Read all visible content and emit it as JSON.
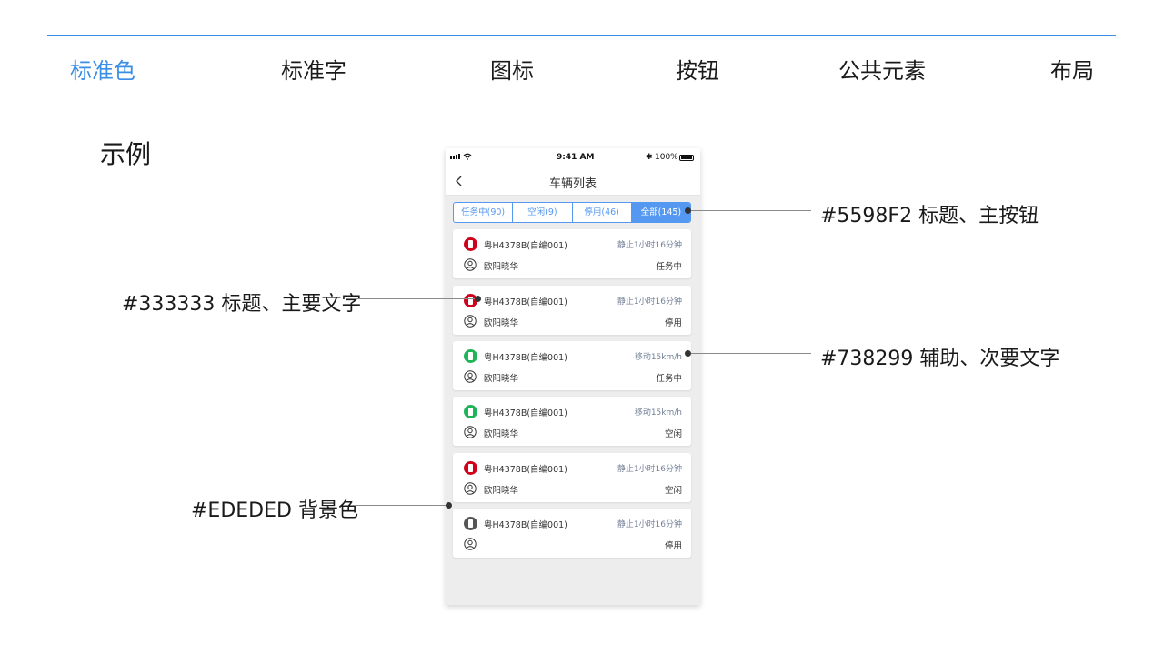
{
  "top_nav": [
    "标准色",
    "标准字",
    "图标",
    "按钮",
    "公共元素",
    "布局"
  ],
  "active_nav": "标准色",
  "section_title": "示例",
  "phone": {
    "status_bar": {
      "time": "9:41 AM",
      "battery": "100%"
    },
    "title": "车辆列表",
    "tabs": [
      "任务中(90)",
      "空闲(9)",
      "停用(46)",
      "全部(145)"
    ],
    "active_tab": "全部(145)",
    "cards": [
      {
        "plate": "粤H4378B(自编001)",
        "status": "静止1小时16分钟",
        "driver": "欧阳晓华",
        "state": "任务中",
        "icon_color": "red"
      },
      {
        "plate": "粤H4378B(自编001)",
        "status": "静止1小时16分钟",
        "driver": "欧阳晓华",
        "state": "停用",
        "icon_color": "red"
      },
      {
        "plate": "粤H4378B(自编001)",
        "status": "移动15km/h",
        "driver": "欧阳晓华",
        "state": "任务中",
        "icon_color": "green"
      },
      {
        "plate": "粤H4378B(自编001)",
        "status": "移动15km/h",
        "driver": "欧阳晓华",
        "state": "空闲",
        "icon_color": "green"
      },
      {
        "plate": "粤H4378B(自编001)",
        "status": "静止1小时16分钟",
        "driver": "欧阳晓华",
        "state": "空闲",
        "icon_color": "red"
      },
      {
        "plate": "粤H4378B(自编001)",
        "status": "静止1小时16分钟",
        "driver": "",
        "state": "停用",
        "icon_color": "gray"
      }
    ]
  },
  "annotations": {
    "primary": "#5598F2 标题、主按钮",
    "text_main": "#333333 标题、主要文字",
    "text_secondary": "#738299 辅助、次要文字",
    "background": "#EDEDED 背景色"
  },
  "colors": {
    "primary": "#5598F2",
    "text_main": "#333333",
    "text_secondary": "#738299",
    "background": "#EDEDED",
    "accent_nav": "#3a8ee6",
    "icon_red": "#d0021b",
    "icon_green": "#1fb45a",
    "icon_gray": "#555555"
  }
}
